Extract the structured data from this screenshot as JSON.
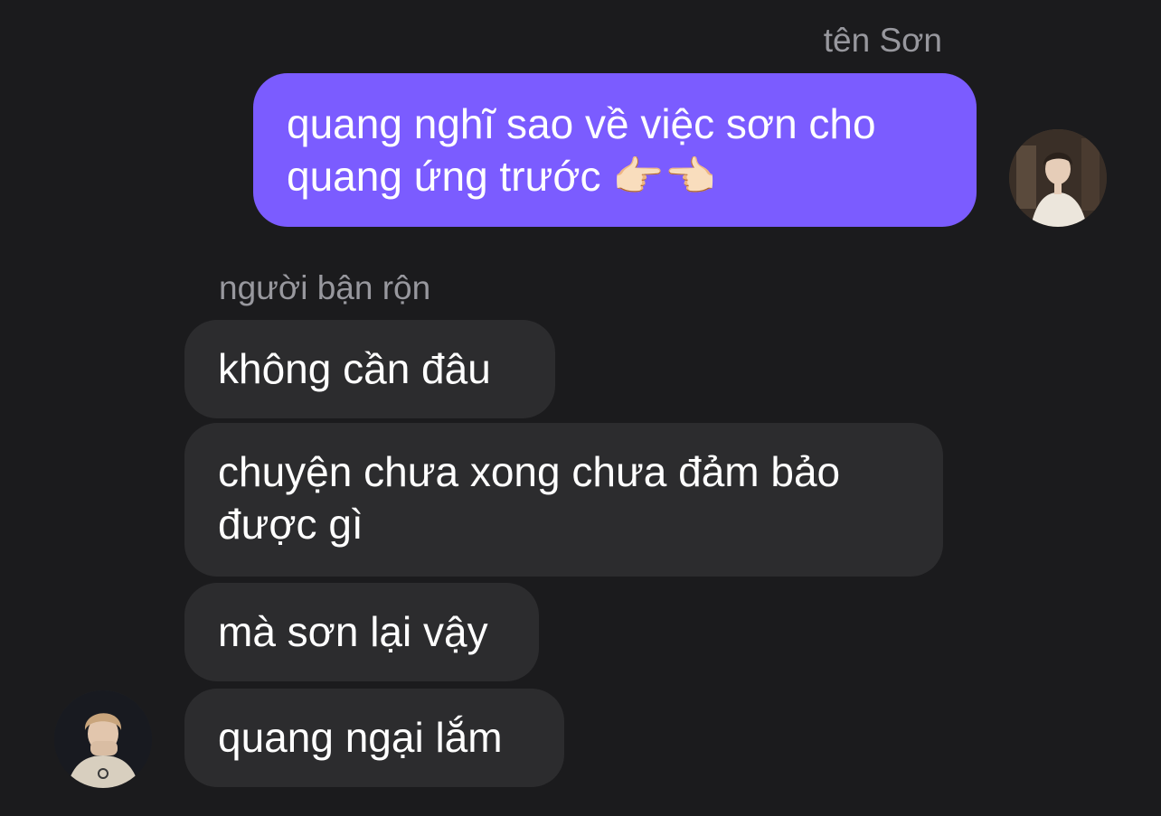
{
  "conversation": {
    "outgoing": {
      "sender": "tên Sơn",
      "messages": [
        "quang nghĩ sao về việc sơn cho quang ứng trước 👉🏻👈🏻"
      ]
    },
    "incoming": {
      "sender": "người bận rộn",
      "messages": [
        "không cần đâu",
        "chuyện chưa xong chưa đảm bảo được gì",
        "mà sơn lại vậy",
        "quang ngại lắm"
      ]
    }
  },
  "colors": {
    "background": "#1b1b1d",
    "outgoing_bubble": "#7b5cff",
    "incoming_bubble": "#2c2c2e",
    "sender_name": "#98989e"
  }
}
